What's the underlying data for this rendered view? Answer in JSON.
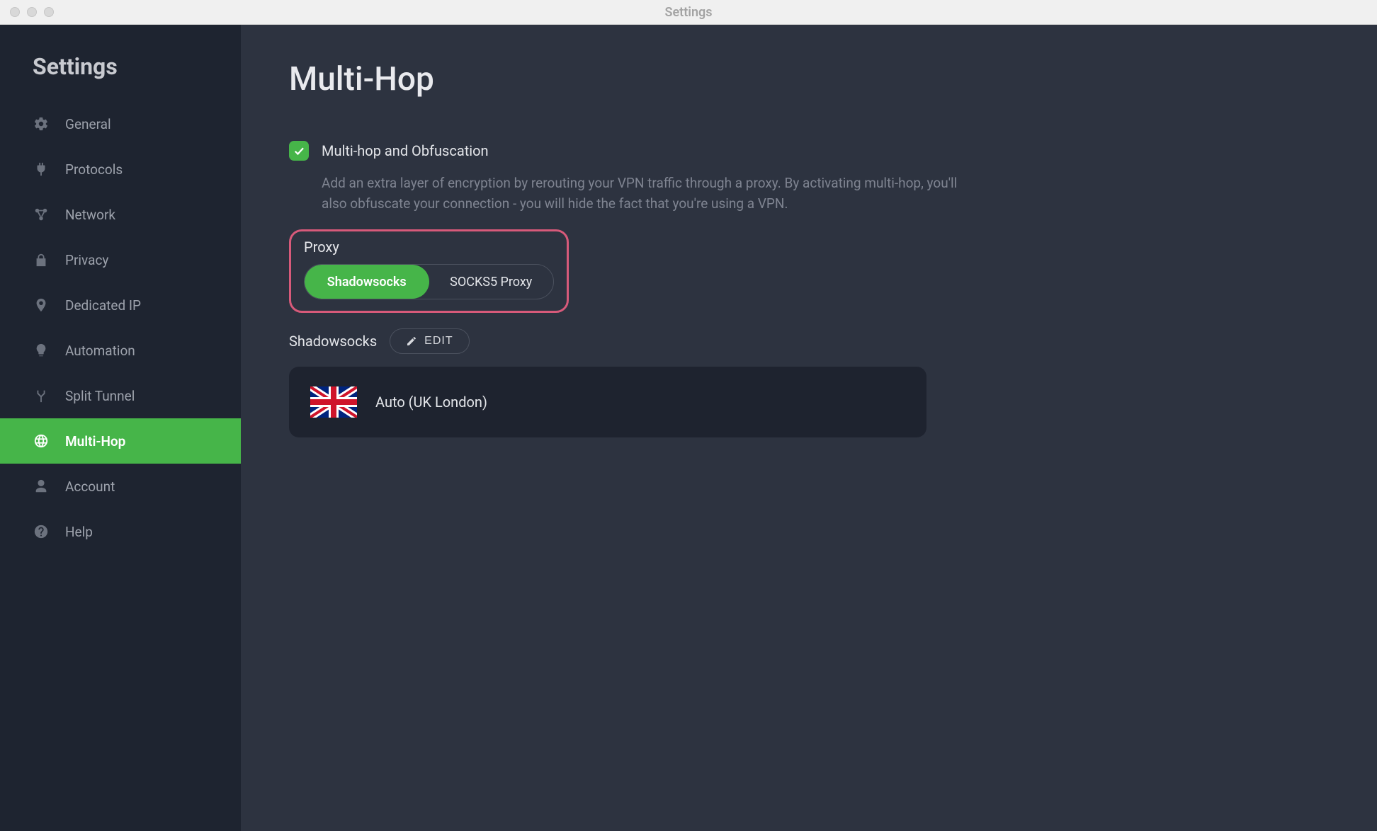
{
  "window": {
    "title": "Settings"
  },
  "sidebar": {
    "title": "Settings",
    "items": [
      {
        "label": "General",
        "icon": "gear"
      },
      {
        "label": "Protocols",
        "icon": "plug"
      },
      {
        "label": "Network",
        "icon": "network"
      },
      {
        "label": "Privacy",
        "icon": "lock"
      },
      {
        "label": "Dedicated IP",
        "icon": "ip"
      },
      {
        "label": "Automation",
        "icon": "bulb"
      },
      {
        "label": "Split Tunnel",
        "icon": "split"
      },
      {
        "label": "Multi-Hop",
        "icon": "globe",
        "active": true
      },
      {
        "label": "Account",
        "icon": "person"
      },
      {
        "label": "Help",
        "icon": "help"
      }
    ]
  },
  "main": {
    "title": "Multi-Hop",
    "setting": {
      "checked": true,
      "label": "Multi-hop and Obfuscation",
      "description": "Add an extra layer of encryption by rerouting your VPN traffic through a proxy. By activating multi-hop, you'll also obfuscate your connection - you will hide the fact that you're using a VPN."
    },
    "proxy": {
      "label": "Proxy",
      "options": [
        "Shadowsocks",
        "SOCKS5 Proxy"
      ],
      "selected": "Shadowsocks"
    },
    "shadowsocks": {
      "label": "Shadowsocks",
      "edit_label": "EDIT",
      "location": "Auto (UK London)"
    }
  }
}
